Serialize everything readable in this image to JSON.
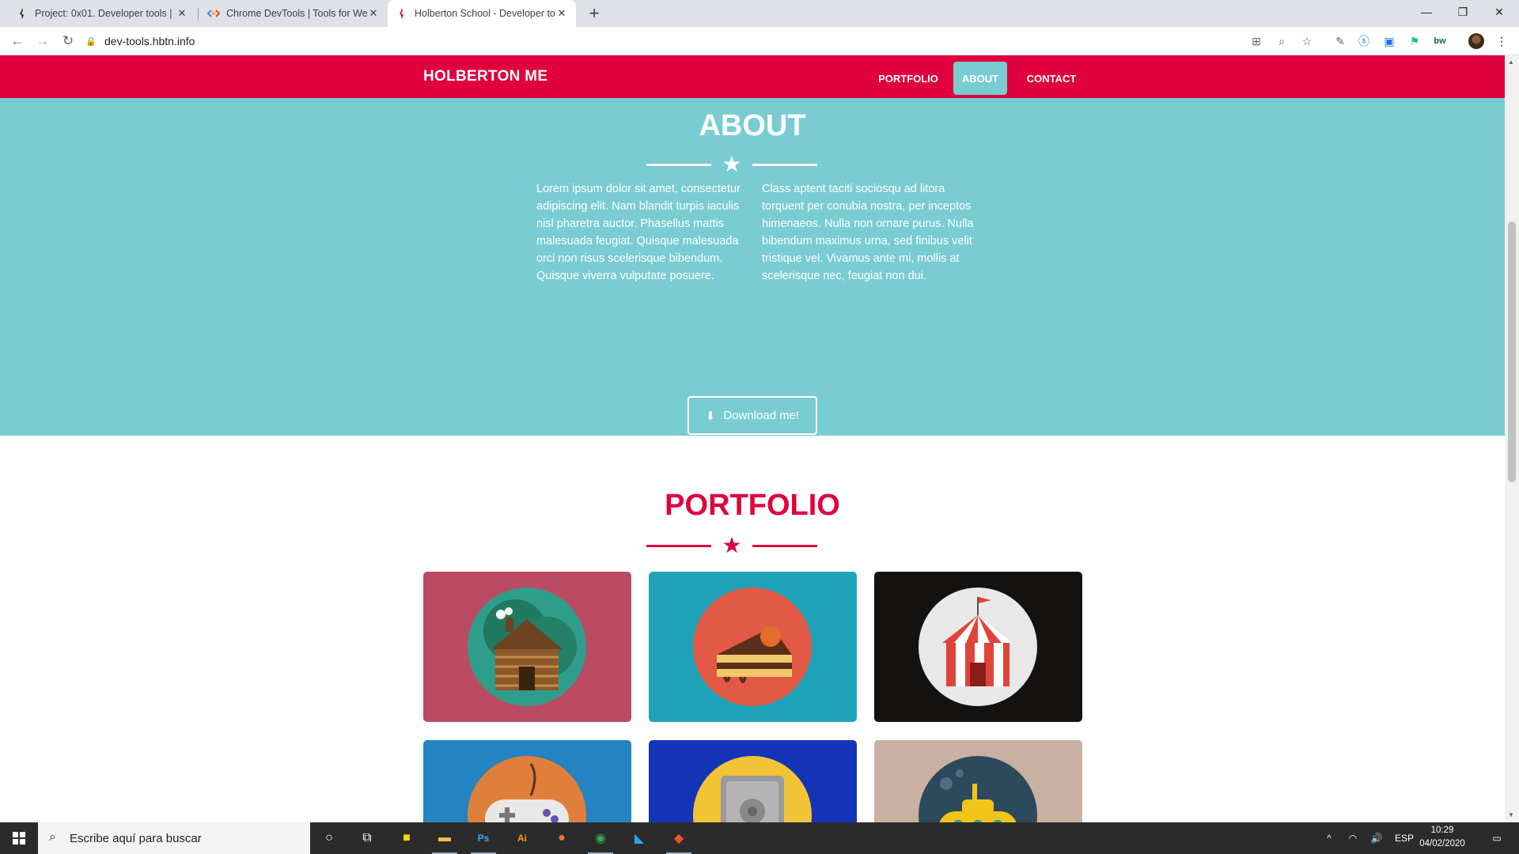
{
  "browser": {
    "tabs": [
      {
        "title": "Project: 0x01. Developer tools | H",
        "icon": "holberton-favicon",
        "active": false
      },
      {
        "title": "Chrome DevTools  |  Tools for We",
        "icon": "devtools-favicon",
        "active": false
      },
      {
        "title": "Holberton School - Developer to",
        "icon": "holberton-favicon",
        "active": true
      }
    ],
    "new_tab_label": "+",
    "url": "dev-tools.hbtn.info",
    "window_controls": [
      "minimize",
      "restore",
      "close"
    ]
  },
  "site": {
    "brand": "HOLBERTON ME",
    "nav": [
      {
        "label": "PORTFOLIO",
        "active": false
      },
      {
        "label": "ABOUT",
        "active": true
      },
      {
        "label": "CONTACT",
        "active": false
      }
    ],
    "about": {
      "title": "ABOUT",
      "col1": "Lorem ipsum dolor sit amet, consectetur adipiscing elit. Nam blandit turpis iaculis nisl pharetra auctor. Phasellus mattis malesuada feugiat. Quisque malesuada orci non risus scelerisque bibendum. Quisque viverra vulputate posuere.",
      "col2": "Class aptent taciti sociosqu ad litora torquent per conubia nostra, per inceptos himenaeos. Nulla non ornare purus. Nulla bibendum maximus urna, sed finibus velit tristique vel. Vivamus ante mi, mollis at scelerisque nec, feugiat non dui.",
      "download_label": "Download me!",
      "bg_color": "#78ccd2"
    },
    "portfolio": {
      "title": "PORTFOLIO",
      "items": [
        {
          "name": "cabin",
          "bg": "#bb4b62",
          "circle": "#2f9d8b"
        },
        {
          "name": "cake",
          "bg": "#20a3b8",
          "circle": "#e25a45"
        },
        {
          "name": "circus",
          "bg": "#141111",
          "circle": "#e8e8e8"
        },
        {
          "name": "game-controller",
          "bg": "#2384c1",
          "circle": "#e07f3c"
        },
        {
          "name": "safe",
          "bg": "#1434b8",
          "circle": "#f1c337"
        },
        {
          "name": "submarine",
          "bg": "#cab0a0",
          "circle": "#2c4a5c"
        }
      ]
    },
    "accent_color": "#e0003d"
  },
  "taskbar": {
    "search_placeholder": "Escribe aquí para buscar",
    "apps": [
      "cortana",
      "task-view",
      "sticky-notes",
      "file-explorer",
      "photoshop",
      "illustrator",
      "firefox",
      "chrome",
      "vscode",
      "git"
    ],
    "language": "ESP",
    "time": "10:29",
    "date": "04/02/2020"
  }
}
